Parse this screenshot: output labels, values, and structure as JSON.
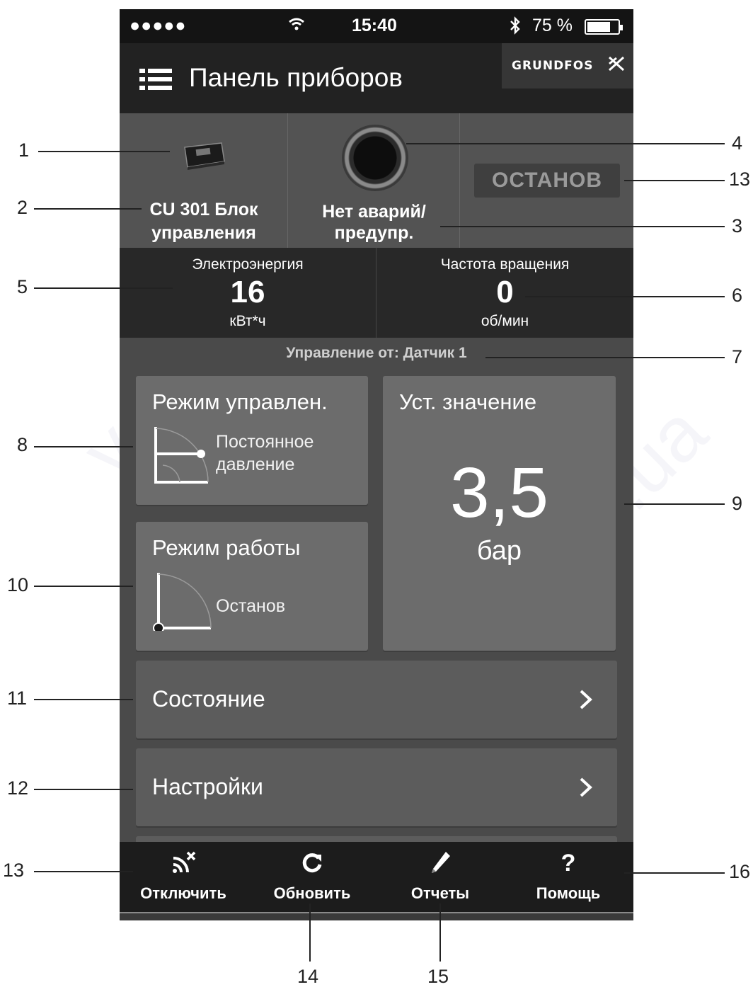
{
  "status_bar": {
    "signal": "●●●●●",
    "time": "15:40",
    "battery": "75 %"
  },
  "header": {
    "title": "Панель приборов",
    "brand": "GRUNDFOS"
  },
  "info": {
    "device_name_line1": "CU 301 Блок",
    "device_name_line2": "управления",
    "alarm_line1": "Нет аварий/",
    "alarm_line2": "предупр.",
    "state_badge": "ОСТАНОВ"
  },
  "metrics": {
    "energy": {
      "label": "Электроэнергия",
      "value": "16",
      "unit": "кВт*ч"
    },
    "speed": {
      "label": "Частота вращения",
      "value": "0",
      "unit": "об/мин"
    }
  },
  "control_source": "Управление от: Датчик 1",
  "tiles": {
    "control_mode": {
      "title": "Режим управлен.",
      "line1": "Постоянное",
      "line2": "давление"
    },
    "setpoint": {
      "title": "Уст. значение",
      "value": "3,5",
      "unit": "бар"
    },
    "operating_mode": {
      "title": "Режим работы",
      "value": "Останов"
    }
  },
  "rows": {
    "status": "Состояние",
    "settings": "Настройки"
  },
  "tabbar": {
    "disconnect": "Отключить",
    "refresh": "Обновить",
    "reports": "Отчеты",
    "help": "Помощь",
    "help_glyph": "?"
  },
  "callouts": {
    "n1": "1",
    "n2": "2",
    "n3": "3",
    "n4": "4",
    "n5": "5",
    "n6": "6",
    "n7": "7",
    "n8": "8",
    "n9": "9",
    "n10": "10",
    "n11": "11",
    "n12": "12",
    "n13a": "13",
    "n13b": "13",
    "n14": "14",
    "n15": "15",
    "n16": "16"
  },
  "watermark": "voltar.com.ua"
}
